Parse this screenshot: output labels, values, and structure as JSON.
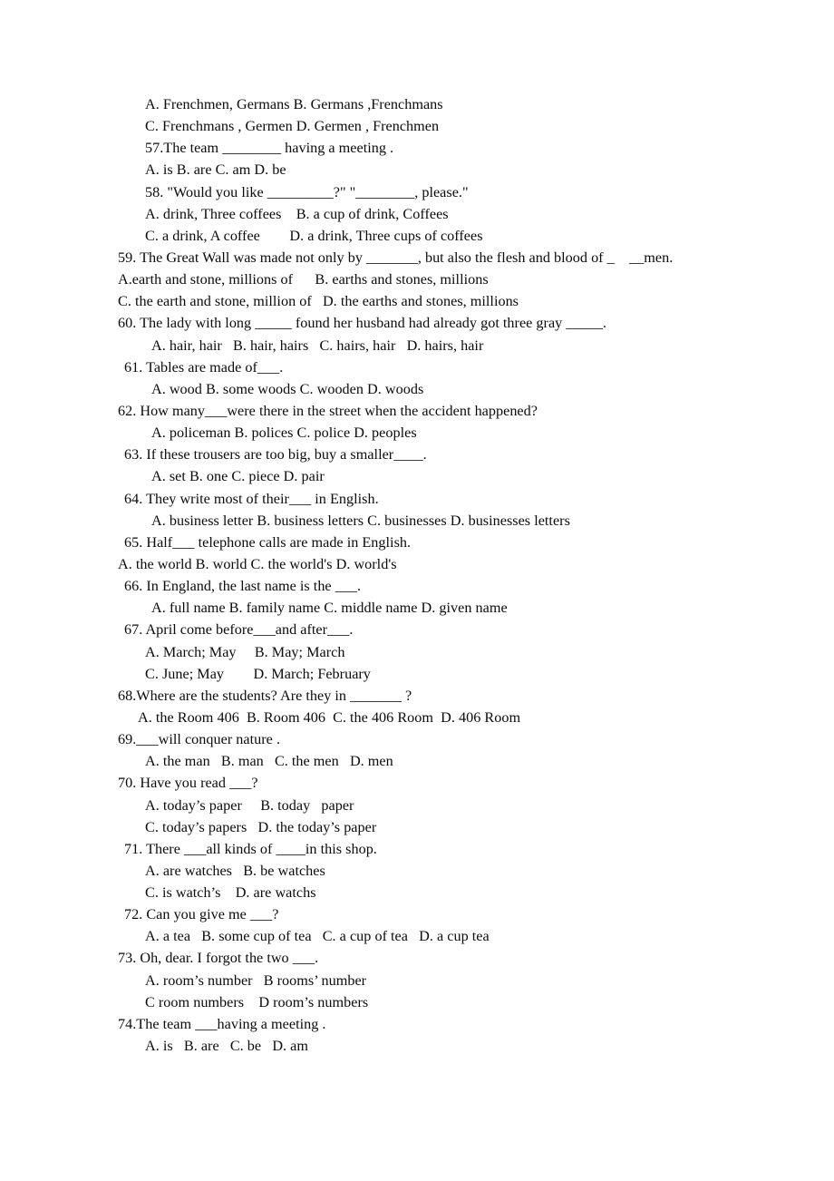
{
  "document": {
    "kind": "scanned-worksheet",
    "page_background": "#ffffff",
    "text_color": "#0b0b0b",
    "lines": [
      {
        "id": "q56-opt-ab",
        "indent": "i4",
        "text": "A. Frenchmen, Germans B. Germans ,Frenchmans"
      },
      {
        "id": "q56-opt-cd",
        "indent": "i4",
        "text": "C. Frenchmans , Germen D. Germen , Frenchmen"
      },
      {
        "id": "q57-stem",
        "indent": "i4",
        "text": "57.The team ________ having a meeting ."
      },
      {
        "id": "q57-opts",
        "indent": "i4",
        "text": "A. is B. are C. am D. be"
      },
      {
        "id": "q58-stem",
        "indent": "i4",
        "text": "58. \"Would you like _________?\" \"________, please.\""
      },
      {
        "id": "q58-opt-ab",
        "indent": "i4",
        "text": "A. drink, Three coffees    B. a cup of drink, Coffees"
      },
      {
        "id": "q58-opt-cd",
        "indent": "i4",
        "text": "C. a drink, A coffee        D. a drink, Three cups of coffees"
      },
      {
        "id": "q59-stem",
        "indent": "i0",
        "text": "59. The Great Wall was made not only by _______, but also the flesh and blood of _    __men."
      },
      {
        "id": "q59-opt-ab",
        "indent": "i0",
        "text": "A.earth and stone, millions of      B. earths and stones, millions"
      },
      {
        "id": "q59-opt-cd",
        "indent": "i0",
        "text": "C. the earth and stone, million of   D. the earths and stones, millions"
      },
      {
        "id": "q60-stem",
        "indent": "i0",
        "text": "60. The lady with long _____ found her husband had already got three gray _____."
      },
      {
        "id": "q60-opts",
        "indent": "i5",
        "text": "A. hair, hair   B. hair, hairs   C. hairs, hair   D. hairs, hair"
      },
      {
        "id": "q61-stem",
        "indent": "i1",
        "text": "61. Tables are made of___."
      },
      {
        "id": "q61-opts",
        "indent": "i5",
        "text": "A. wood B. some woods C. wooden D. woods"
      },
      {
        "id": "q62-stem",
        "indent": "i0",
        "text": "62. How many___were there in the street when the accident happened?"
      },
      {
        "id": "q62-opts",
        "indent": "i5",
        "text": "A. policeman B. polices C. police D. peoples"
      },
      {
        "id": "q63-stem",
        "indent": "i1",
        "text": "63. If these trousers are too big, buy a smaller____."
      },
      {
        "id": "q63-opts",
        "indent": "i5",
        "text": "A. set B. one C. piece D. pair"
      },
      {
        "id": "q64-stem",
        "indent": "i1",
        "text": "64. They write most of their___ in English."
      },
      {
        "id": "q64-opts",
        "indent": "i5",
        "text": "A. business letter B. business letters C. businesses D. businesses letters"
      },
      {
        "id": "q65-stem",
        "indent": "i1",
        "text": "65. Half___ telephone calls are made in English."
      },
      {
        "id": "q65-opts",
        "indent": "i0",
        "text": "A. the world B. world C. the world's D. world's"
      },
      {
        "id": "q66-stem",
        "indent": "i1",
        "text": "66. In England, the last name is the ___."
      },
      {
        "id": "q66-opts",
        "indent": "i5",
        "text": "A. full name B. family name C. middle name D. given name"
      },
      {
        "id": "q67-stem",
        "indent": "i1",
        "text": "67. April come before___and after___."
      },
      {
        "id": "q67-opt-ab",
        "indent": "i4",
        "text": "A. March; May     B. May; March"
      },
      {
        "id": "q67-opt-cd",
        "indent": "i4",
        "text": "C. June; May        D. March; February"
      },
      {
        "id": "q68-stem",
        "indent": "i0",
        "text": "68.Where are the students? Are they in _______ ?"
      },
      {
        "id": "q68-opts",
        "indent": "i3",
        "text": "A. the Room 406  B. Room 406  C. the 406 Room  D. 406 Room"
      },
      {
        "id": "q69-stem",
        "indent": "i0",
        "text": "69.___will conquer nature ."
      },
      {
        "id": "q69-opts",
        "indent": "i4",
        "text": "A. the man   B. man   C. the men   D. men"
      },
      {
        "id": "q70-stem",
        "indent": "i0",
        "text": "70. Have you read ___?"
      },
      {
        "id": "q70-opt-ab",
        "indent": "i4",
        "text": "A. today’s paper     B. today   paper"
      },
      {
        "id": "q70-opt-cd",
        "indent": "i4",
        "text": "C. today’s papers   D. the today’s paper"
      },
      {
        "id": "q71-stem",
        "indent": "i1",
        "text": "71. There ___all kinds of ____in this shop."
      },
      {
        "id": "q71-opt-ab",
        "indent": "i4",
        "text": "A. are watches   B. be watches"
      },
      {
        "id": "q71-opt-cd",
        "indent": "i4",
        "text": "C. is watch’s    D. are watchs"
      },
      {
        "id": "q72-stem",
        "indent": "i1",
        "text": "72. Can you give me ___?"
      },
      {
        "id": "q72-opts",
        "indent": "i4",
        "text": "A. a tea   B. some cup of tea   C. a cup of tea   D. a cup tea"
      },
      {
        "id": "q73-stem",
        "indent": "i0",
        "text": "73. Oh, dear. I forgot the two ___."
      },
      {
        "id": "q73-opt-ab",
        "indent": "i4",
        "text": "A. room’s number   B rooms’ number"
      },
      {
        "id": "q73-opt-cd",
        "indent": "i4",
        "text": "C room numbers    D room’s numbers"
      },
      {
        "id": "q74-stem",
        "indent": "i0",
        "text": "74.The team ___having a meeting ."
      },
      {
        "id": "q74-opts",
        "indent": "i4",
        "text": "A. is   B. are   C. be   D. am"
      }
    ]
  }
}
